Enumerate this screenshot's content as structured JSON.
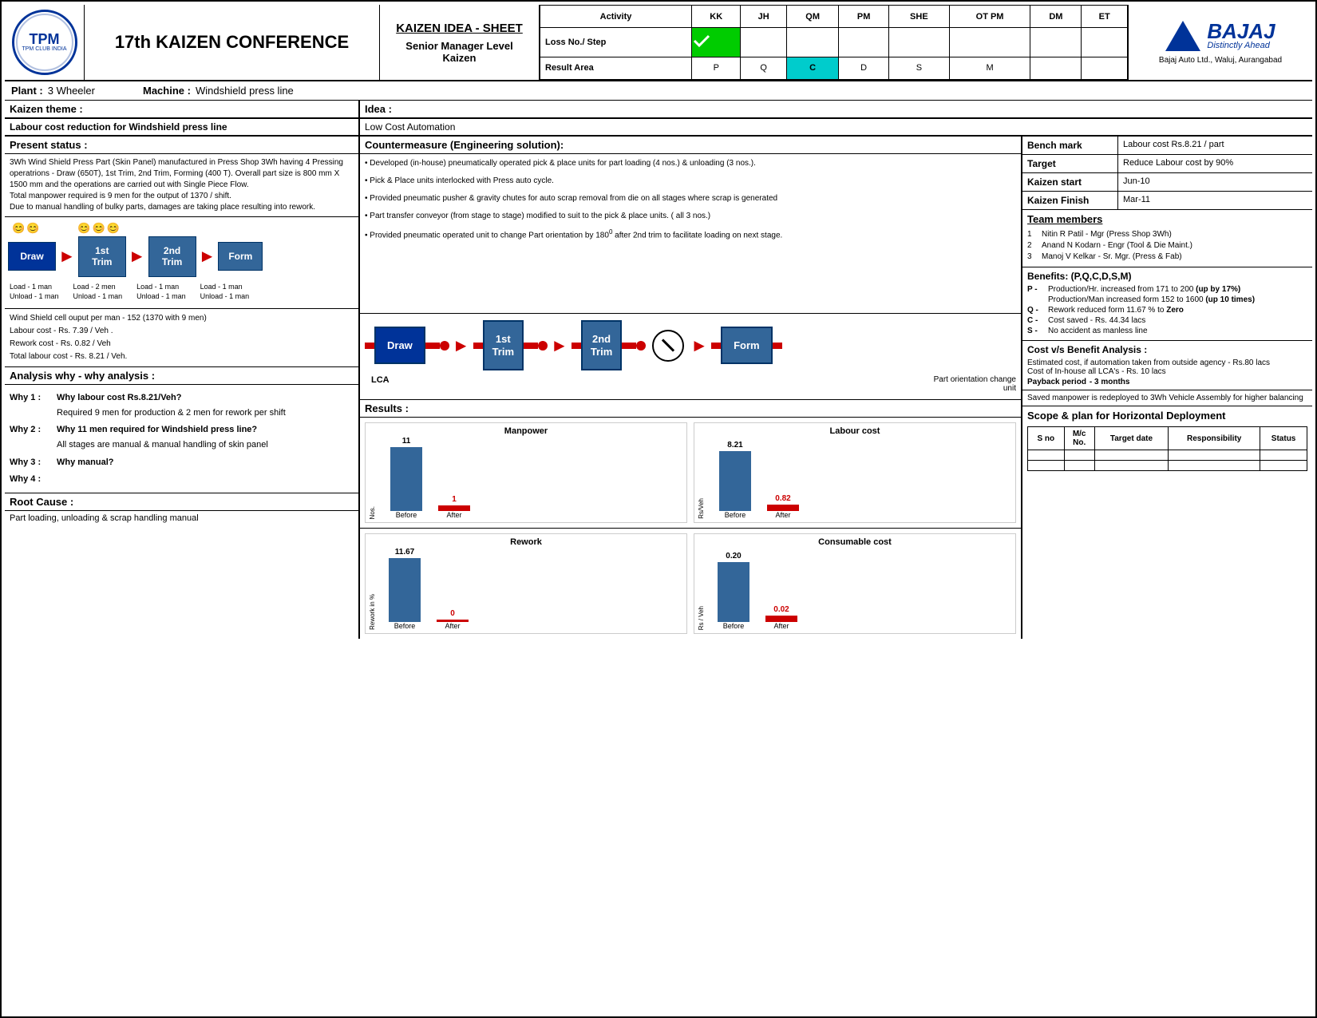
{
  "header": {
    "conference_title": "17th KAIZEN CONFERENCE",
    "kaizen_sheet_title": "KAIZEN IDEA - SHEET",
    "level": "Senior Manager Level",
    "kaizen": "Kaizen",
    "activity": "Activity",
    "columns": [
      "KK",
      "JH",
      "QM",
      "PM",
      "SHE",
      "OT PM",
      "DM",
      "ET"
    ],
    "row1_label": "Loss No./ Step",
    "row2_label": "Result Area",
    "result_values": [
      "P",
      "Q",
      "C",
      "D",
      "S",
      "M"
    ],
    "bajaj_name": "BAJAJ",
    "bajaj_slogan": "Distinctly Ahead",
    "bajaj_company": "Bajaj Auto Ltd., Waluj, Aurangabad"
  },
  "plant": {
    "label": "Plant :",
    "value": "3 Wheeler",
    "machine_label": "Machine :",
    "machine_value": "Windshield press line"
  },
  "kaizen_theme": {
    "label": "Kaizen theme :",
    "value": "Labour cost reduction for Windshield press line",
    "idea_label": "Idea  :",
    "idea_value": "Low Cost Automation"
  },
  "present_status": {
    "title": "Present status :",
    "content": "3Wh Wind Shield Press Part (Skin Panel) manufactured in Press Shop 3Wh having 4 Pressing operatrions - Draw (650T), 1st Trim, 2nd Trim, Forming (400 T). Overall part size is 800 mm X 1500 mm and the operations are carried out with Single Piece Flow.\nTotal manpower required is 9 men for the output of 1370 / shift.\nDue to manual handling of bulky parts, damages are taking place resulting into rework."
  },
  "process_before": {
    "boxes": [
      "Draw",
      "1st\nTrim",
      "2nd\nTrim",
      "Form"
    ],
    "load_labels": [
      {
        "load": "Load  - 1 man",
        "unload": "Unload - 1 man"
      },
      {
        "load": "Load  - 2 men",
        "unload": "Unload - 1 man"
      },
      {
        "load": "Load  - 1 man",
        "unload": "Unload - 1 man"
      },
      {
        "load": "Load  - 1 man",
        "unload": "Unload - 1 man"
      }
    ]
  },
  "stats": {
    "output": "Wind Shield cell ouput per man - 152 (1370 with 9 men)",
    "labour_cost": "Labour cost     - Rs. 7.39 /  Veh .",
    "rework_cost": "Rework cost    - Rs. 0.82 / Veh",
    "total_labour": "Total labour cost  - Rs. 8.21 / Veh."
  },
  "analysis": {
    "title": "Analysis why - why analysis :",
    "why1_label": "Why 1 :",
    "why1_bold": "Why labour cost Rs.8.21/Veh?",
    "why1_content": "Required 9 men for production & 2 men for rework per shift",
    "why2_label": "Why 2 :",
    "why2_bold": "Why 11 men required for Windshield press line?",
    "why2_content": "All stages are manual & manual handling of skin panel",
    "why3_label": "Why 3 :",
    "why3_content": "Why manual?",
    "why4_label": "Why 4 :",
    "why4_content": ""
  },
  "root_cause": {
    "title": "Root Cause :",
    "content": "Part loading, unloading & scrap handling manual"
  },
  "countermeasure": {
    "title": "Countermeasure (Engineering solution):",
    "items": [
      "• Developed (in-house) pneumatically operated pick & place units for part loading (4 nos.) & unloading (3 nos.).",
      "• Pick & Place units interlocked with Press auto cycle.",
      "• Provided pneumatic pusher & gravity chutes for auto scrap removal from die on all stages where scrap is generated",
      "• Part transfer conveyor (from stage to stage) modified to suit to the pick & place units. ( all 3 nos.)",
      "• Provided pneumatic operated unit to change Part orientation by 180° after 2nd trim to facilitate loading on next stage."
    ]
  },
  "after_process": {
    "boxes": [
      "Draw",
      "1st\nTrim",
      "2nd\nTrim",
      "Form"
    ],
    "lca_label": "LCA",
    "orientation_label": "Part orientation change unit"
  },
  "results": {
    "title": "Results :",
    "manpower_chart": {
      "title": "Manpower",
      "y_label": "Nos.",
      "before_value": 11,
      "after_value": 1,
      "before_label": "Before",
      "after_label": "After"
    },
    "labour_cost_chart": {
      "title": "Labour cost",
      "y_label": "Rs/Veh",
      "before_value": 8.21,
      "after_value": 0.82,
      "before_label": "Before",
      "after_label": "After"
    },
    "rework_chart": {
      "title": "Rework",
      "y_label": "Rework in %",
      "before_value": 11.67,
      "after_value": 0,
      "before_label": "Before",
      "after_label": "After"
    },
    "consumable_chart": {
      "title": "Consumable cost",
      "y_label": "Rs / Veh",
      "before_value": 0.2,
      "after_value": 0.02,
      "before_label": "Before",
      "after_label": "After"
    }
  },
  "benchmarks": {
    "bench_label": "Bench mark",
    "bench_value": "Labour cost Rs.8.21 / part",
    "target_label": "Target",
    "target_value": "Reduce Labour cost by 90%",
    "start_label": "Kaizen start",
    "start_value": "Jun-10",
    "finish_label": "Kaizen Finish",
    "finish_value": "Mar-11"
  },
  "team": {
    "title": "Team members",
    "members": [
      {
        "num": "1",
        "name": "Nitin R Patil - Mgr (Press Shop 3Wh)"
      },
      {
        "num": "2",
        "name": "Anand N Kodarn - Engr (Tool & Die Maint.)"
      },
      {
        "num": "3",
        "name": "Manoj V Kelkar - Sr. Mgr. (Press & Fab)"
      }
    ]
  },
  "benefits": {
    "title": "Benefits: (P,Q,C,D,S,M)",
    "items": [
      {
        "label": "P -",
        "text": "Production/Hr. increased from 171 to 200 ",
        "bold": "(up by 17%)",
        "text2": ""
      },
      {
        "label": "",
        "text": "Production/Man increased form 152 to 1600 ",
        "bold": "(up 10 times)",
        "text2": ""
      },
      {
        "label": "Q -",
        "text": "Rework reduced form 11.67 % to ",
        "bold": "Zero",
        "text2": ""
      },
      {
        "label": "C -",
        "text": "Cost saved - Rs. 44.34 lacs",
        "bold": "",
        "text2": ""
      },
      {
        "label": "S -",
        "text": "No accident as manless line",
        "bold": "",
        "text2": ""
      }
    ]
  },
  "cost_analysis": {
    "title": "Cost v/s Benefit Analysis :",
    "line1": "Estimated cost, if automation taken from outside agency - Rs.80 lacs",
    "line2": "Cost of In-house all LCA's                                          - Rs. 10 lacs",
    "payback_label": "Payback period",
    "payback_value": "- 3 months"
  },
  "saved": {
    "text": "Saved manpower is redeployed to 3Wh Vehicle Assembly for higher balancing"
  },
  "scope": {
    "title": "Scope & plan for Horizontal Deployment",
    "table_headers": [
      "S no",
      "M/c\nNo.",
      "Target date",
      "Responsibility",
      "Status"
    ],
    "rows": [
      [
        "",
        "",
        "",
        "",
        ""
      ],
      [
        "",
        "",
        "",
        "",
        ""
      ]
    ]
  }
}
